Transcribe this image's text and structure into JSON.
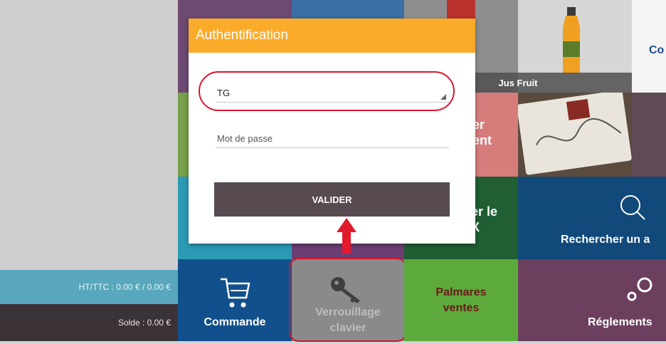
{
  "left_panel": {
    "total_label": "HT/TTC : 0.00 € / 0.00 €",
    "solde_label": "Solde : 0.00 €"
  },
  "tiles": {
    "jus_fruit": "Jus Fruit",
    "co_partial": "Co",
    "salmon_line1": "er",
    "salmon_line2": "ent",
    "darkgreen_line1": "er le",
    "darkgreen_line2": "X",
    "search": "Rechercher un a",
    "commande": "Commande",
    "verrouillage_line1": "Verrouillage",
    "verrouillage_line2": "clavier",
    "palmares_line1": "Palmares",
    "palmares_line2": "ventes",
    "reglements": "Réglements"
  },
  "modal": {
    "title": "Authentification",
    "user_select_value": "TG",
    "password_placeholder": "Mot de passe",
    "submit_label": "VALIDER"
  },
  "colors": {
    "modal_header": "#fbab2a",
    "submit_button": "#574a50",
    "annotation": "#d6162e"
  },
  "icons": [
    "cart-icon",
    "key-icon",
    "search-icon",
    "gears-icon",
    "dropdown-arrow-icon",
    "red-up-arrow-annotation"
  ]
}
